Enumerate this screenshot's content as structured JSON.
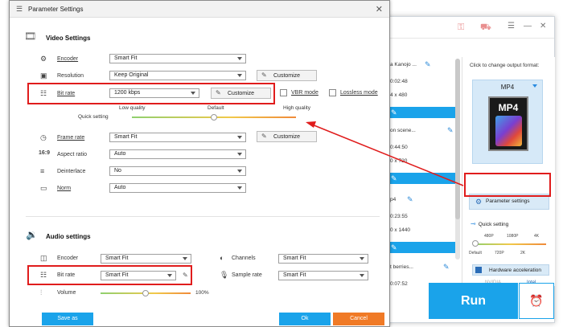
{
  "dialog": {
    "title": "Parameter Settings",
    "close_glyph": "✕"
  },
  "video": {
    "section_title": "Video Settings",
    "encoder": {
      "label": "Encoder",
      "value": "Smart Fit"
    },
    "resolution": {
      "label": "Resolution",
      "value": "Keep Original",
      "customize": "Customize"
    },
    "bitrate": {
      "label": "Bit rate",
      "value": "1200 kbps",
      "customize": "Customize"
    },
    "vbr_mode": "VBR mode",
    "lossless_mode": "Lossless mode",
    "quick": {
      "title": "Quick setting",
      "low": "Low quality",
      "default": "Default",
      "high": "High quality",
      "level": 0.5
    },
    "frame_rate": {
      "label": "Frame rate",
      "value": "Smart Fit",
      "customize": "Customize"
    },
    "aspect_ratio": {
      "label": "Aspect ratio",
      "value": "Auto"
    },
    "deinterlace": {
      "label": "Deinterlace",
      "value": "No"
    },
    "norm": {
      "label": "Norm",
      "value": "Auto"
    }
  },
  "audio": {
    "section_title": "Audio settings",
    "encoder": {
      "label": "Encoder",
      "value": "Smart Fit"
    },
    "channels": {
      "label": "Channels",
      "value": "Smart Fit"
    },
    "bitrate": {
      "label": "Bit rate",
      "value": "Smart Fit"
    },
    "sample_rate": {
      "label": "Sample rate",
      "value": "Smart Fit"
    },
    "volume": {
      "label": "Volume",
      "value": "100%",
      "level": 0.5
    }
  },
  "footer": {
    "save_as": "Save as",
    "ok": "Ok",
    "cancel": "Cancel"
  },
  "app": {
    "items": [
      {
        "title": "a Kanojo ...",
        "duration": "0:02:48",
        "size": "4 x 480"
      },
      {
        "title": "on scene...",
        "duration": "0:44:50",
        "size": "0 x 720"
      },
      {
        "title": "p4",
        "duration": "0:23:55",
        "size": "0 x 1440"
      },
      {
        "title": "t berries...",
        "duration": "0:07:52",
        "size": ""
      }
    ],
    "output_hint": "Click to change output format:",
    "format_name": "MP4",
    "format_icon_label": "MP4",
    "parameter_settings": "Parameter settings",
    "quick_setting": "Quick setting",
    "qs_top": [
      "480P",
      "1080P",
      "4K"
    ],
    "qs_bottom": [
      "Default",
      "720P",
      "2K"
    ],
    "hardware_accel": "Hardware acceleration",
    "vendors": [
      "NVIDIA",
      "Intel"
    ],
    "run": "Run"
  },
  "colors": {
    "accent": "#1aa3ea",
    "highlight": "#e01c1c",
    "footer_save": "#1aa3ea",
    "footer_ok": "#1aa3ea",
    "footer_cancel": "#f07a26"
  }
}
